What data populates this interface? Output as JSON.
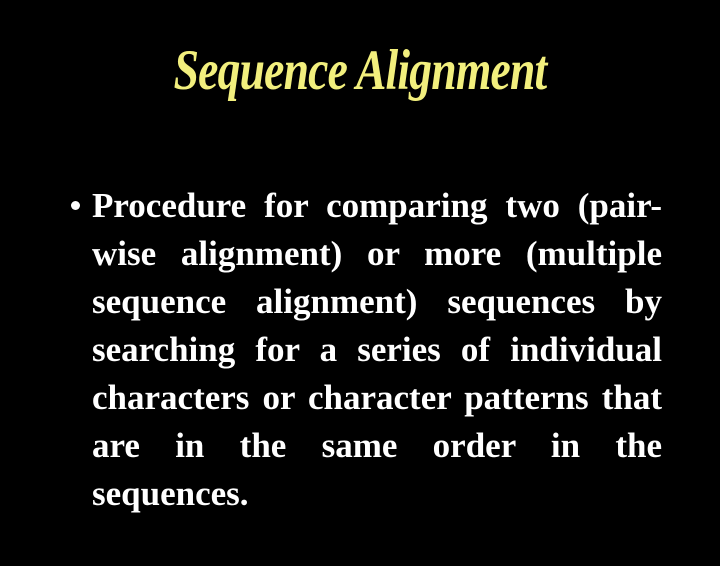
{
  "slide": {
    "background_color": "#000000",
    "title": {
      "text": "Sequence Alignment",
      "color": "#f2ef7d"
    },
    "body": {
      "color": "#ffffff",
      "bullets": [
        {
          "marker": "round-bullet",
          "text": "Procedure for comparing two (pair-wise alignment) or more (multiple sequence alignment) sequences by searching for a series of individual characters or character patterns that are in the same order in the sequences."
        }
      ]
    }
  }
}
